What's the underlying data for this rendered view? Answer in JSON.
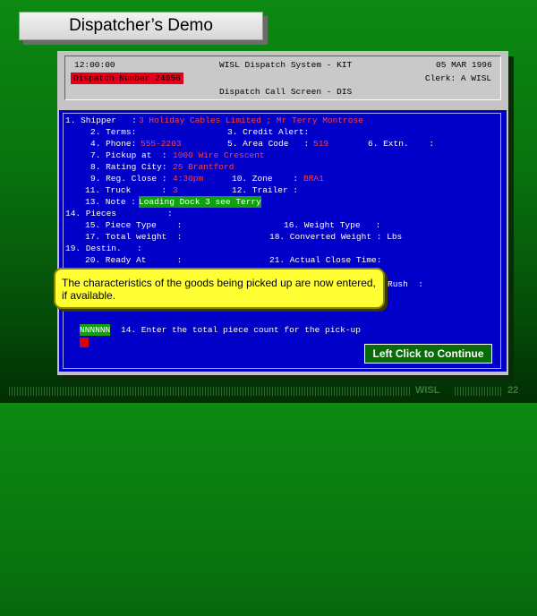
{
  "title": "Dispatcher’s Demo",
  "header": {
    "time": "12:00:00",
    "system": "WISL Dispatch System - KIT",
    "date": "05 MAR 1996",
    "dispatch_number": "Dispatch Number 24056",
    "clerk": "Clerk: A WISL",
    "screen": "Dispatch Call Screen - DIS"
  },
  "form": {
    "shipper_label": "1. Shipper   :",
    "shipper_value": "3 Holiday Cables Limited ; Mr Terry Montrose",
    "terms_label": "2. Terms:",
    "credit_label": "3. Credit Alert:",
    "phone_label": "4. Phone:",
    "phone_value": "555-2203",
    "area_label": "5. Area Code   :",
    "area_value": "519",
    "extn_label": "6. Extn.    :",
    "pickup_label": "7. Pickup at  :",
    "pickup_value": "1000 Wire Crescent",
    "rating_label": "8. Rating City:",
    "rating_value": "25 Brantford",
    "regclose_label": "9. Reg. Close :",
    "regclose_value": "4:30pm",
    "zone_label": "10. Zone    :",
    "zone_value": "BRA1",
    "truck_label": "11. Truck      :",
    "truck_value": "3",
    "trailer_label": "12. Trailer :",
    "note_label": "13. Note :",
    "note_value": "Loading Dock 3 see Terry",
    "pieces_label": "14. Pieces          :",
    "piece_type_label": "15. Piece Type    :",
    "weight_type_label": "16. Weight Type   :",
    "total_weight_label": "17. Total weight  :",
    "conv_weight_label": "18. Converted Weight : Lbs",
    "destin_label": "19. Destin.   :",
    "ready_label": "20. Ready At      :",
    "actual_close_label": "21. Actual Close Time:",
    "rush_label": "Rush  :",
    "input_value": "NNNNNN",
    "prompt": "14. Enter the total piece count for the pick-up"
  },
  "tooltip": "The characteristics of the goods being picked up are now entered, if available.",
  "continue_label": "Left Click to Continue",
  "footer": {
    "brand": "WISL",
    "page": "22"
  }
}
